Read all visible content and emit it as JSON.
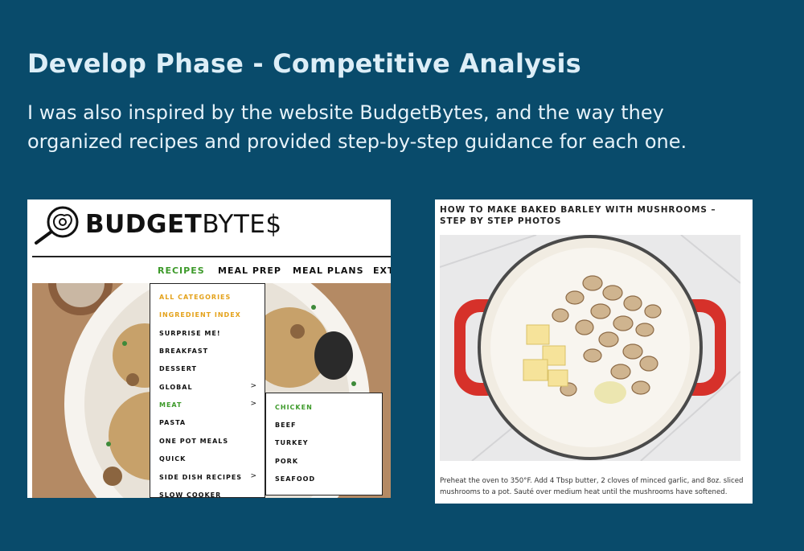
{
  "slide": {
    "title": "Develop Phase - Competitive Analysis",
    "body": "I was also inspired by the website BudgetBytes, and the way they organized recipes and provided step-by-step guidance for each one."
  },
  "budgetbytes": {
    "logo_text_bold": "BUDGET",
    "logo_text_light": "BYTE$",
    "nav": [
      "RECIPES",
      "MEAL PREP",
      "MEAL PLANS",
      "EXT"
    ],
    "menu": [
      {
        "label": "ALL CATEGORIES",
        "style": "orange",
        "arrow": ""
      },
      {
        "label": "INGREDIENT INDEX",
        "style": "orange",
        "arrow": ""
      },
      {
        "label": "SURPRISE ME!",
        "style": "normal",
        "arrow": ""
      },
      {
        "label": "BREAKFAST",
        "style": "normal",
        "arrow": ""
      },
      {
        "label": "DESSERT",
        "style": "normal",
        "arrow": ""
      },
      {
        "label": "GLOBAL",
        "style": "normal",
        "arrow": ">"
      },
      {
        "label": "MEAT",
        "style": "green",
        "arrow": ">"
      },
      {
        "label": "PASTA",
        "style": "normal",
        "arrow": ""
      },
      {
        "label": "ONE POT MEALS",
        "style": "normal",
        "arrow": ""
      },
      {
        "label": "QUICK",
        "style": "normal",
        "arrow": ""
      },
      {
        "label": "SIDE DISH RECIPES",
        "style": "normal",
        "arrow": ">"
      },
      {
        "label": "SLOW COOKER",
        "style": "normal",
        "arrow": ""
      }
    ],
    "submenu": [
      {
        "label": "CHICKEN",
        "style": "green"
      },
      {
        "label": "BEEF",
        "style": "normal"
      },
      {
        "label": "TURKEY",
        "style": "normal"
      },
      {
        "label": "PORK",
        "style": "normal"
      },
      {
        "label": "SEAFOOD",
        "style": "normal"
      }
    ]
  },
  "step_page": {
    "heading": "HOW TO MAKE BAKED BARLEY WITH MUSHROOMS – STEP BY STEP PHOTOS",
    "caption": "Preheat the oven to 350°F. Add 4 Tbsp butter, 2 cloves of minced garlic, and 8oz. sliced mushrooms to a pot. Sauté over medium heat until the mushrooms have softened."
  },
  "colors": {
    "background": "#094b6b",
    "accent_green": "#3d9a2a",
    "accent_orange": "#e4a21b",
    "pot_red": "#d6312a"
  }
}
